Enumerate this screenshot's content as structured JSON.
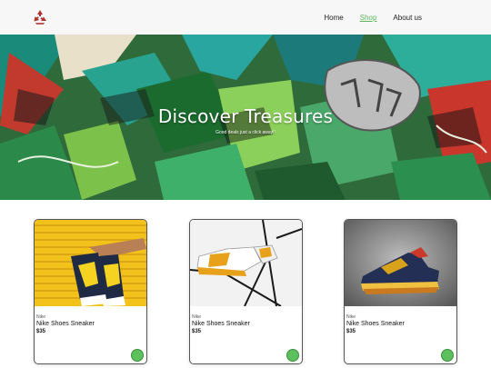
{
  "nav": {
    "logo_icon": "recycle-icon",
    "items": [
      {
        "label": "Home"
      },
      {
        "label": "Shop"
      },
      {
        "label": "About us"
      }
    ],
    "active_color": "#5cb85c"
  },
  "hero": {
    "title": "Discover Treasures",
    "subtitle": "Good deals just a click away!!"
  },
  "products": [
    {
      "brand": "Nike",
      "name": "Nike Shoes Sneaker",
      "price": "$35",
      "cart_icon": "add-to-cart-icon"
    },
    {
      "brand": "Nike",
      "name": "Nike Shoes Sneaker",
      "price": "$35",
      "cart_icon": "add-to-cart-icon"
    },
    {
      "brand": "Nike",
      "name": "Nike Shoes Sneaker",
      "price": "$35",
      "cart_icon": "add-to-cart-icon"
    }
  ],
  "colors": {
    "nav_bg": "#f7f7f7",
    "cart_button": "#5cc05c"
  }
}
